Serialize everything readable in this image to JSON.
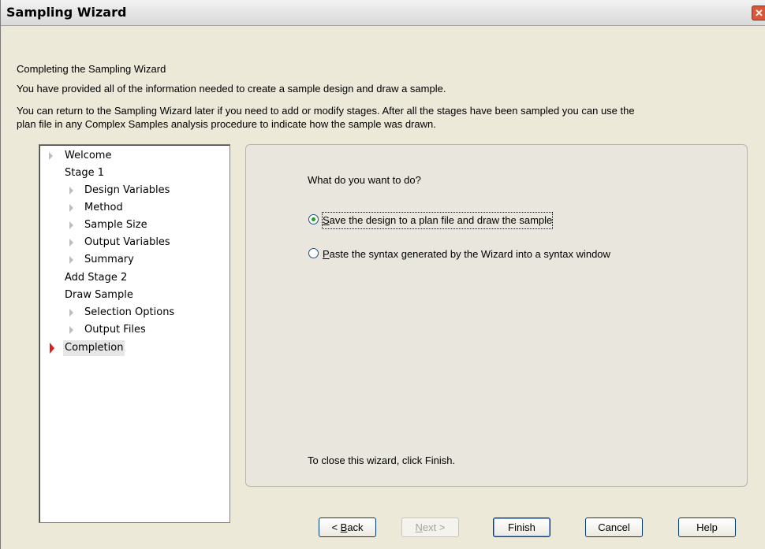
{
  "window": {
    "title": "Sampling Wizard",
    "close_glyph": "✕"
  },
  "intro": {
    "heading": "Completing the Sampling Wizard",
    "line1": "You have provided all of the information needed to create a sample design and draw a sample.",
    "line2": "You can return to the Sampling Wizard later if you need to add or modify stages.  After all the stages have been sampled you can use the",
    "line3": "plan file in any Complex Samples analysis procedure to indicate how the sample was drawn."
  },
  "nav": {
    "welcome": "Welcome",
    "stage1": "Stage 1",
    "design_variables": "Design Variables",
    "method": "Method",
    "sample_size": "Sample Size",
    "output_variables": "Output Variables",
    "summary": "Summary",
    "add_stage2": "Add Stage 2",
    "draw_sample": "Draw Sample",
    "selection_options": "Selection Options",
    "output_files": "Output Files",
    "completion": "Completion",
    "current": "completion",
    "active_marker_color": "#e21a1a"
  },
  "panel": {
    "question": "What do you want to do?",
    "option_save": "Save the design to a plan file and draw the sample",
    "option_paste": "Paste the syntax generated by the Wizard into a syntax window",
    "selected": "save",
    "closing": "To close this wizard, click Finish."
  },
  "buttons": {
    "back_key": "B",
    "back_rest": "ack",
    "next_key": "N",
    "next_rest": "ext",
    "finish": "Finish",
    "cancel": "Cancel",
    "help": "Help"
  }
}
